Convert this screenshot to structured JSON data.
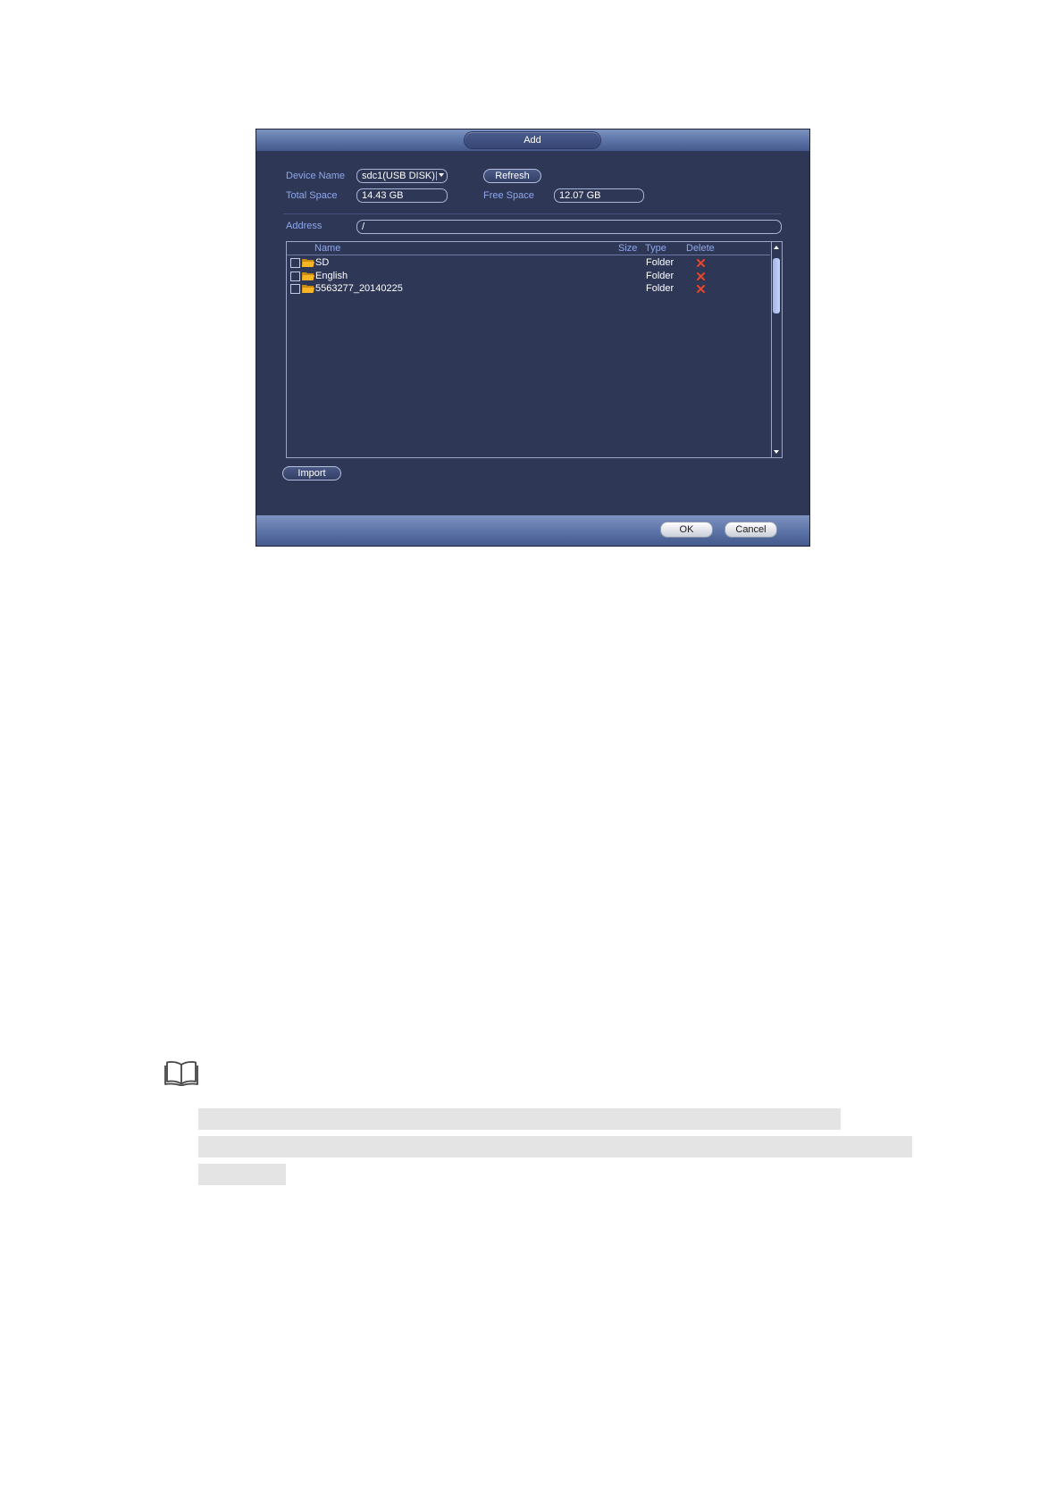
{
  "dialog": {
    "title": "Add",
    "device_name_label": "Device Name",
    "device_name_value": "sdc1(USB DISK)",
    "refresh_label": "Refresh",
    "total_space_label": "Total Space",
    "total_space_value": "14.43 GB",
    "free_space_label": "Free Space",
    "free_space_value": "12.07 GB",
    "address_label": "Address",
    "address_value": "/",
    "columns": {
      "name": "Name",
      "size": "Size",
      "type": "Type",
      "delete": "Delete"
    },
    "files": [
      {
        "name": "SD",
        "size": "",
        "type": "Folder"
      },
      {
        "name": "English",
        "size": "",
        "type": "Folder"
      },
      {
        "name": "5563277_20140225",
        "size": "",
        "type": "Folder"
      }
    ],
    "import_label": "Import",
    "ok_label": "OK",
    "cancel_label": "Cancel"
  },
  "colors": {
    "dialog_bg": "#2e3755",
    "label": "#8fa8ea",
    "delete_icon": "#e8462a",
    "folder_icon": "#f0a818"
  },
  "icons": {
    "note": "open-book-icon",
    "folder": "folder-icon",
    "delete": "delete-x-icon"
  }
}
